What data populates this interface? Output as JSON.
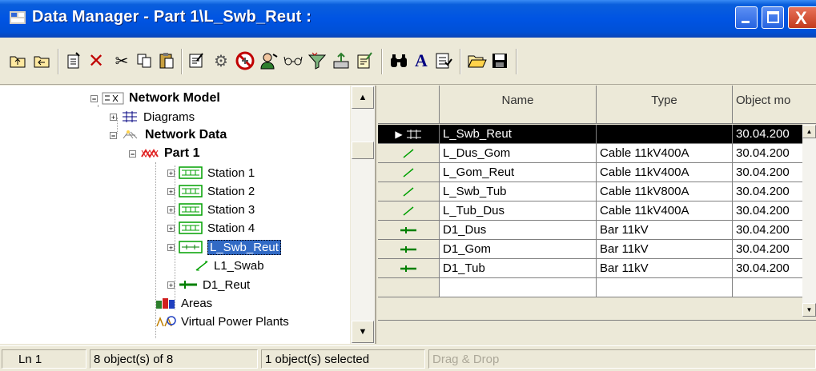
{
  "window": {
    "title": "Data Manager - Part 1\\L_Swb_Reut :",
    "minimize_glyph": "_",
    "maximize_glyph": "□",
    "close_glyph": "X"
  },
  "toolbar": {
    "buttons": [
      {
        "name": "folder-up-icon",
        "glyph": "⤒"
      },
      {
        "name": "folder-back-icon",
        "glyph": "⤓"
      },
      {
        "name": "new-object-icon",
        "glyph": "✎"
      },
      {
        "name": "delete-icon",
        "glyph": "✕"
      },
      {
        "name": "cut-icon",
        "glyph": "✂"
      },
      {
        "name": "copy-icon",
        "glyph": "⎘"
      },
      {
        "name": "paste-icon",
        "glyph": "📋"
      },
      {
        "name": "edit-object-icon",
        "glyph": "✎"
      },
      {
        "name": "settings-icon",
        "glyph": "⚙"
      },
      {
        "name": "prohibit-icon",
        "glyph": "⊘"
      },
      {
        "name": "user-icon",
        "glyph": "👤"
      },
      {
        "name": "glasses-icon",
        "glyph": "👓"
      },
      {
        "name": "filter-icon",
        "glyph": "⧩"
      },
      {
        "name": "export-icon",
        "glyph": "⇪"
      },
      {
        "name": "report-icon",
        "glyph": "✐"
      },
      {
        "name": "binoculars-icon",
        "glyph": "⚲"
      },
      {
        "name": "font-icon",
        "glyph": "A"
      },
      {
        "name": "checklist-icon",
        "glyph": "☑"
      },
      {
        "name": "open-folder-icon",
        "glyph": "📂"
      },
      {
        "name": "save-icon",
        "glyph": "💾"
      }
    ]
  },
  "tree": {
    "items": [
      {
        "label": "Network Model",
        "expander": "−",
        "icon": "network-model-icon"
      },
      {
        "label": "Diagrams",
        "expander": "+",
        "icon": "diagrams-icon"
      },
      {
        "label": "Network Data",
        "expander": "−",
        "icon": "network-data-icon"
      },
      {
        "label": "Part 1",
        "expander": "−",
        "icon": "part-icon"
      },
      {
        "label": "Station 1",
        "expander": "+",
        "icon": "station-icon"
      },
      {
        "label": "Station 2",
        "expander": "+",
        "icon": "station-icon"
      },
      {
        "label": "Station 3",
        "expander": "+",
        "icon": "station-icon"
      },
      {
        "label": "Station 4",
        "expander": "+",
        "icon": "station-icon"
      },
      {
        "label": "L_Swb_Reut",
        "expander": "+",
        "icon": "branch-icon"
      },
      {
        "label": "L1_Swab",
        "expander": "",
        "icon": "line-icon"
      },
      {
        "label": "D1_Reut",
        "expander": "+",
        "icon": "busbar-icon"
      },
      {
        "label": "Areas",
        "expander": "",
        "icon": "areas-icon"
      },
      {
        "label": "Virtual Power Plants",
        "expander": "",
        "icon": "virtual-power-plants-icon"
      }
    ]
  },
  "grid": {
    "columns": [
      "",
      "Name",
      "Type",
      "Object mo"
    ],
    "rows": [
      {
        "marker": "▶",
        "icon": "branch-icon",
        "name": "L_Swb_Reut",
        "type": "",
        "modified": "30.04.200"
      },
      {
        "marker": "",
        "icon": "line-icon",
        "name": "L_Dus_Gom",
        "type": "Cable 11kV400A",
        "modified": "30.04.200"
      },
      {
        "marker": "",
        "icon": "line-icon",
        "name": "L_Gom_Reut",
        "type": "Cable 11kV400A",
        "modified": "30.04.200"
      },
      {
        "marker": "",
        "icon": "line-icon",
        "name": "L_Swb_Tub",
        "type": "Cable 11kV800A",
        "modified": "30.04.200"
      },
      {
        "marker": "",
        "icon": "line-icon",
        "name": "L_Tub_Dus",
        "type": "Cable 11kV400A",
        "modified": "30.04.200"
      },
      {
        "marker": "",
        "icon": "busbar-icon",
        "name": "D1_Dus",
        "type": "Bar 11kV",
        "modified": "30.04.200"
      },
      {
        "marker": "",
        "icon": "busbar-icon",
        "name": "D1_Gom",
        "type": "Bar 11kV",
        "modified": "30.04.200"
      },
      {
        "marker": "",
        "icon": "busbar-icon",
        "name": "D1_Tub",
        "type": "Bar 11kV",
        "modified": "30.04.200"
      }
    ]
  },
  "statusbar": {
    "line": "Ln 1",
    "objects": "8 object(s) of 8",
    "selected": "1 object(s) selected",
    "dragdrop": "Drag & Drop"
  },
  "colors": {
    "title_blue": "#0054E3",
    "selection_blue": "#316AC5",
    "line_green": "#008000",
    "station_green": "#00A000"
  }
}
